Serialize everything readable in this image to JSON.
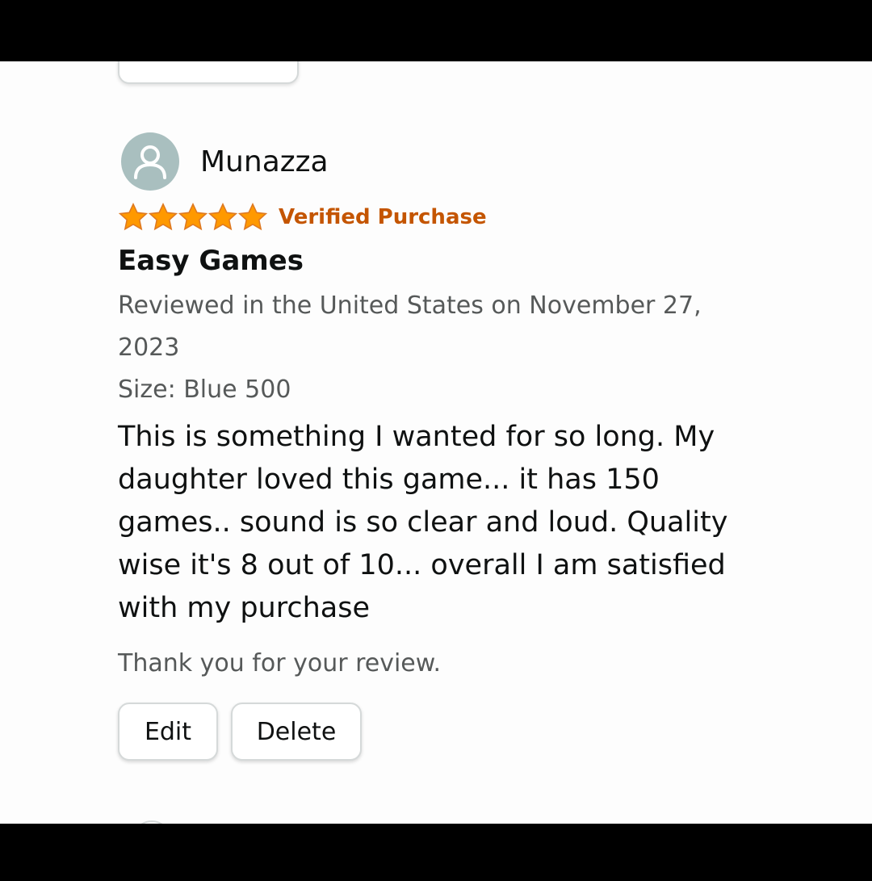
{
  "review": {
    "reviewer_name": "Munazza",
    "rating": 5,
    "max_rating": 5,
    "verified_label": "Verified Purchase",
    "title": "Easy Games",
    "date_line": "Reviewed in the United States on November 27, 2023",
    "size_line": "Size: Blue 500",
    "body": "This is something I wanted for so long. My daughter loved this game... it has 150 games.. sound is so clear and loud. Quality wise it's 8 out of 10... overall I am satisfied with my purchase",
    "thanks_text": "Thank you for your review.",
    "edit_label": "Edit",
    "delete_label": "Delete"
  },
  "icons": {
    "avatar": "person-icon",
    "star": "star-icon"
  },
  "colors": {
    "star": "#ff9900",
    "verified": "#c45500",
    "avatar_bg": "#a9bfbf"
  }
}
